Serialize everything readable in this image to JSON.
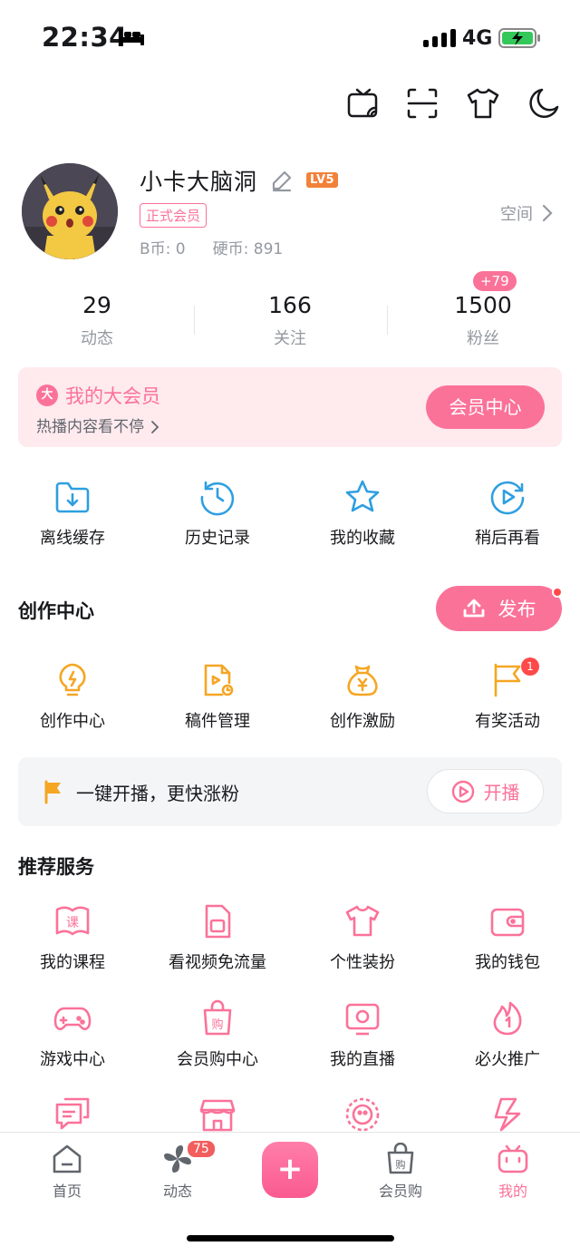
{
  "status_bar": {
    "time": "22:34",
    "network": "4G"
  },
  "profile": {
    "username": "小卡大脑洞",
    "level": "LV5",
    "vip_badge": "正式会员",
    "b_coin": "B币: 0",
    "coin": "硬币: 891",
    "space_link": "空间"
  },
  "stats": [
    {
      "value": "29",
      "label": "动态"
    },
    {
      "value": "166",
      "label": "关注"
    },
    {
      "value": "1500",
      "label": "粉丝"
    }
  ],
  "fans_increment": "+79",
  "vip_banner": {
    "icon_text": "大",
    "title": "我的大会员",
    "subtitle": "热播内容看不停",
    "button": "会员中心"
  },
  "quick_actions": [
    "离线缓存",
    "历史记录",
    "我的收藏",
    "稍后再看"
  ],
  "creation": {
    "section_title": "创作中心",
    "publish_label": "发布",
    "items": [
      "创作中心",
      "稿件管理",
      "创作激励",
      "有奖活动"
    ],
    "activity_badge": "1"
  },
  "live_bar": {
    "text": "一键开播，更快涨粉",
    "button": "开播"
  },
  "services": {
    "section_title": "推荐服务",
    "items": [
      "我的课程",
      "看视频免流量",
      "个性装扮",
      "我的钱包",
      "游戏中心",
      "会员购中心",
      "我的直播",
      "必火推广"
    ],
    "icon_texts": {
      "course": "课",
      "shop": "购"
    }
  },
  "bottom_nav": {
    "items": [
      "首页",
      "动态",
      "会员购",
      "我的"
    ],
    "dynamic_badge": "75",
    "center_label": "+",
    "active": "我的"
  },
  "colors": {
    "accent": "#fb7299",
    "blue_icon": "#2e9fe0",
    "yellow_icon": "#f5a623",
    "text_secondary": "#9499a0"
  }
}
